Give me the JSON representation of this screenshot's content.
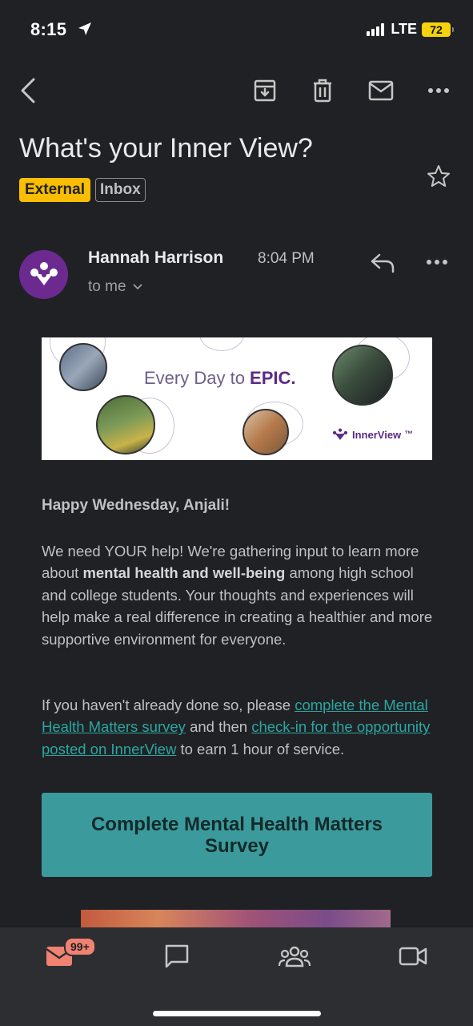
{
  "status_bar": {
    "time": "8:15",
    "network": "LTE",
    "battery": "72"
  },
  "email": {
    "subject": "What's your Inner View?",
    "labels": [
      "External",
      "Inbox"
    ],
    "sender": "Hannah Harrison",
    "time": "8:04 PM",
    "recipient": "to me"
  },
  "banner": {
    "tagline_pre": "Every Day to ",
    "tagline_bold": "EPIC.",
    "brand": "InnerView",
    "brand_tm": "™"
  },
  "body": {
    "greeting": "Happy Wednesday, Anjali!",
    "p1_pre": "We need YOUR help! We're gathering input to learn more about ",
    "p1_bold": "mental health and well-being",
    "p1_post": " among high school and college students. Your thoughts and experiences will help make a real difference in creating a healthier and more supportive environment for everyone.",
    "p2_a": "If you haven't already done so, please ",
    "p2_link1": "complete the Mental Health Matters survey",
    "p2_b": " and then ",
    "p2_link2": "check-in for the opportunity posted on InnerView",
    "p2_c": " to earn 1 hour of service.",
    "cta": "Complete Mental Health Matters Survey"
  },
  "bottom_nav": {
    "mail_badge": "99+"
  },
  "colors": {
    "accent_label": "#f9bd02",
    "link": "#2aa7a3",
    "cta_bg": "#3b9b9c",
    "badge": "#f08272",
    "avatar": "#6c2a91"
  }
}
